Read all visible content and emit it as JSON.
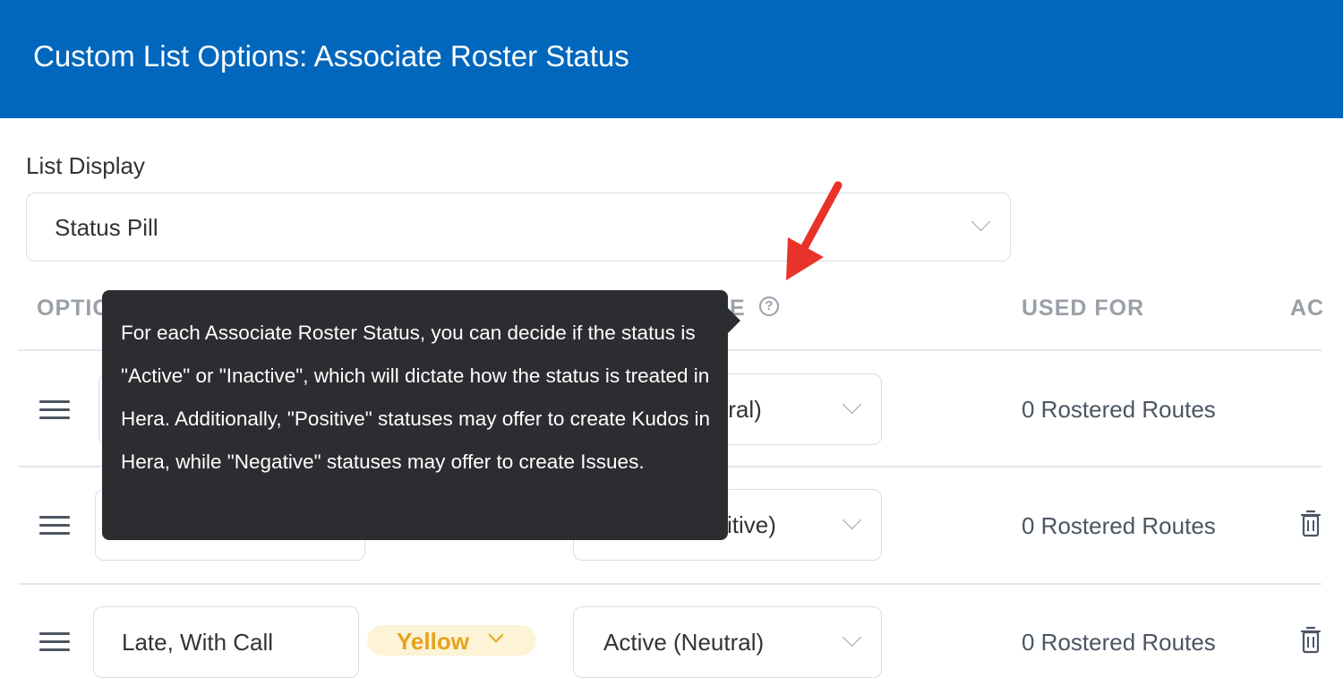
{
  "header": {
    "title": "Custom List Options: Associate Roster Status"
  },
  "list_display": {
    "label": "List Display",
    "selected": "Status Pill"
  },
  "columns": {
    "option_partial": "OPTIC",
    "status_partial": "E",
    "used_for": "USED FOR",
    "actions_partial": "AC"
  },
  "rows": [
    {
      "status_partial": "tral)",
      "used_for": "0 Rostered Routes",
      "has_delete": false
    },
    {
      "status_partial": "sitive)",
      "used_for": "0 Rostered Routes",
      "has_delete": true
    },
    {
      "name": "Late, With Call",
      "color": "Yellow",
      "status": "Active (Neutral)",
      "used_for": "0 Rostered Routes",
      "has_delete": true
    }
  ],
  "tooltip": {
    "text": "For each Associate Roster Status, you can decide if the status is \"Active\" or \"Inactive\", which will dictate how the status is treated in Hera. Additionally, \"Positive\" statuses may offer to create Kudos in Hera, while \"Negative\" statuses may offer to create Issues."
  },
  "colors": {
    "header_bg": "#0167bd",
    "tooltip_bg": "#2c2d30",
    "annotation_arrow": "#e8332a",
    "pill_yellow_bg": "#fdf3d6",
    "pill_yellow_text": "#e5a41c"
  },
  "icons": [
    "help-circle-icon",
    "drag-handle-icon",
    "chevron-down-icon",
    "trash-icon"
  ]
}
